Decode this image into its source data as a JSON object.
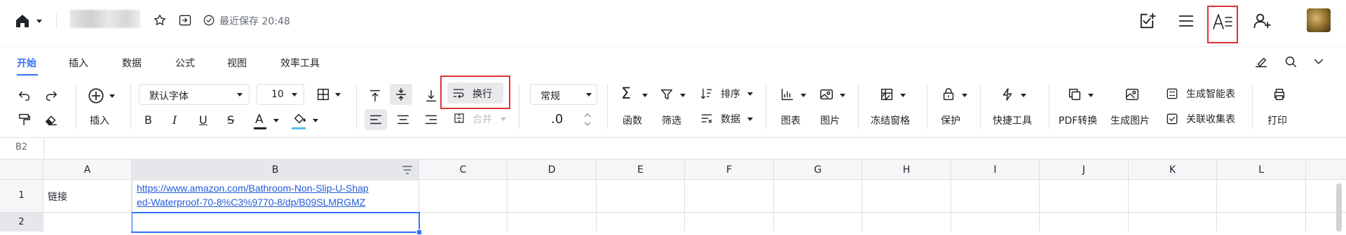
{
  "header": {
    "doc_title_blurred": "",
    "save_status": "最近保存 20:48"
  },
  "tabs": [
    {
      "label": "开始",
      "active": true
    },
    {
      "label": "插入"
    },
    {
      "label": "数据"
    },
    {
      "label": "公式"
    },
    {
      "label": "视图"
    },
    {
      "label": "效率工具"
    }
  ],
  "toolbar": {
    "insert_label": "插入",
    "font_name": "默认字体",
    "font_size": "10",
    "wrap_label": "换行",
    "merge_label": "合并",
    "number_format": "常规",
    "decimal_label": ".0",
    "functions_label": "函数",
    "filter_label": "筛选",
    "sort_label": "排序",
    "data_label": "数据",
    "chart_label": "图表",
    "image_label": "图片",
    "freeze_label": "冻结窗格",
    "protect_label": "保护",
    "quicktools_label": "快捷工具",
    "pdf_label": "PDF转换",
    "genimg_label": "生成图片",
    "smarttable_label": "生成智能表",
    "linkcollect_label": "关联收集表",
    "print_label": "打印"
  },
  "cell_ref": "B2",
  "columns": [
    "A",
    "B",
    "C",
    "D",
    "E",
    "F",
    "G",
    "H",
    "I",
    "J",
    "K",
    "L"
  ],
  "rows": [
    {
      "num": "1",
      "a": "链接",
      "b": "https://www.amazon.com/Bathroom-Non-Slip-U-Shaped-Waterproof-70-8%C3%9770-8/dp/B09SLMRGMZ",
      "b_line1": "https://www.amazon.com/Bathroom-Non-Slip-U-Shap",
      "b_line2": "ed-Waterproof-70-8%C3%9770-8/dp/B09SLMRGMZ"
    },
    {
      "num": "2",
      "a": "",
      "b": ""
    }
  ],
  "colors": {
    "accent": "#3370ff",
    "highlight": "#e03131",
    "link": "#245bdb"
  }
}
